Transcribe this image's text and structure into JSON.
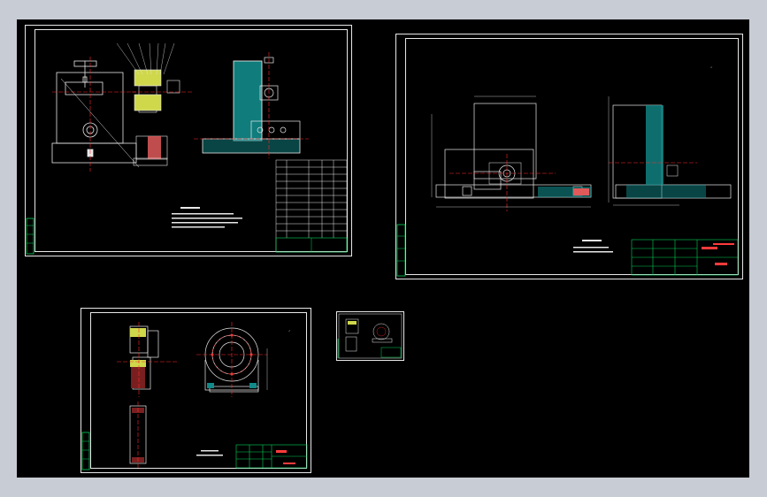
{
  "viewport": {
    "background": "#c8ccd4",
    "drawing_bg": "#000000"
  },
  "colors": {
    "line": "#e8e8e8",
    "center_line": "#ff2a2a",
    "accent_green": "#00d45a",
    "accent_cyan": "#18c8c8",
    "hatch_yellow": "#e6e600",
    "dim_line": "#22cc22"
  },
  "sheets": [
    {
      "id": "assembly-drawing",
      "kind": "fixture assembly drawing",
      "has_parts_list": true,
      "has_tech_notes": true
    },
    {
      "id": "fixture-body-drawing",
      "kind": "part drawing",
      "has_title_block": true
    },
    {
      "id": "part-drawing-small-left",
      "kind": "part drawing",
      "has_title_block": true
    },
    {
      "id": "thumbnail-drawing",
      "kind": "thumbnail overview"
    }
  ],
  "icons": [
    "roughness-symbol-icon"
  ]
}
